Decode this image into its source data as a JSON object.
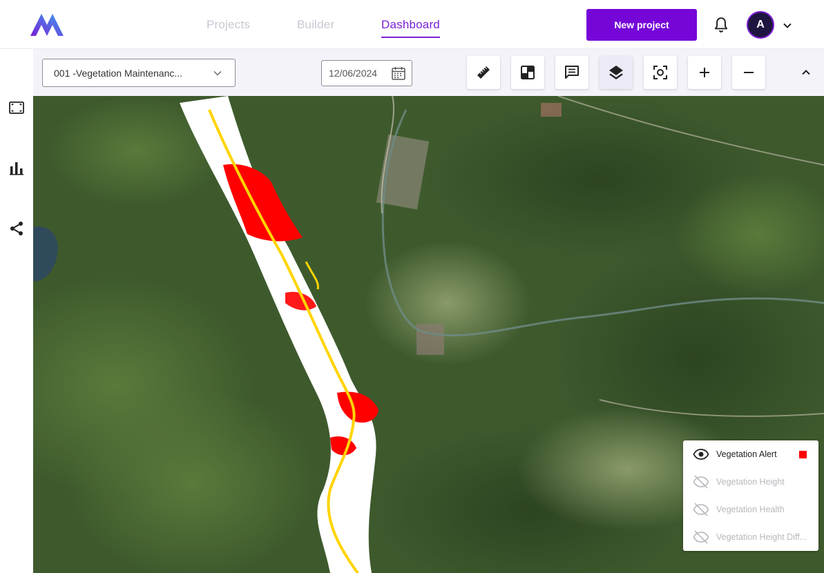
{
  "nav": {
    "items": [
      {
        "label": "Projects",
        "active": false
      },
      {
        "label": "Builder",
        "active": false
      },
      {
        "label": "Dashboard",
        "active": true
      }
    ],
    "new_project_label": "New project",
    "avatar_initial": "A"
  },
  "sidebar": {
    "icons": [
      "area-select-icon",
      "bar-chart-icon",
      "share-icon"
    ]
  },
  "toolbar": {
    "project_select_value": "001 -Vegetation Maintenanc...",
    "date_value": "12/06/2024",
    "tools": [
      "ruler-icon",
      "compare-map-icon",
      "comment-icon",
      "layers-icon",
      "focus-icon",
      "zoom-in-icon",
      "zoom-out-icon"
    ],
    "selected_tool": "layers-icon"
  },
  "legend": {
    "items": [
      {
        "label": "Vegetation Alert",
        "visible": true,
        "color": "#ff0000"
      },
      {
        "label": "Vegetation Height",
        "visible": false
      },
      {
        "label": "Vegetation Health",
        "visible": false
      },
      {
        "label": "Vegetation Height Diff...",
        "visible": false
      }
    ]
  },
  "colors": {
    "accent": "#7606d8",
    "alert": "#ff0000",
    "powerline": "#ffd400"
  }
}
